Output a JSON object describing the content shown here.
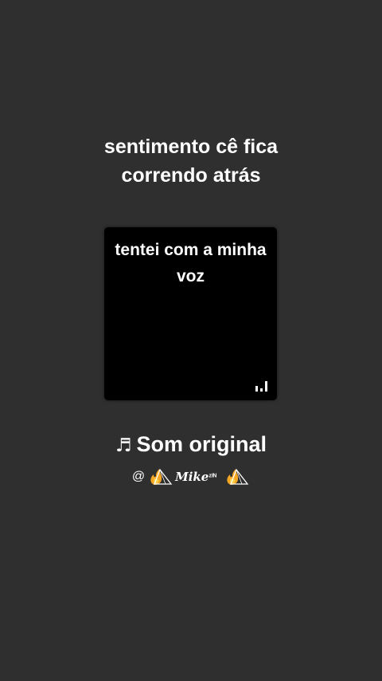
{
  "caption": {
    "line1": "sentimento cê fica",
    "line2": "correndo atrás"
  },
  "cover": {
    "text_line1": "tentei com a minha",
    "text_line2": "voz",
    "badge_icon": "audio-bars-icon"
  },
  "sound": {
    "note_icon": "♬",
    "title": "Som original"
  },
  "author": {
    "at": "@",
    "name": "Mike",
    "superscript": "ᶻᴵᴺ",
    "emblem_icon": "fire-triangle-emblem-icon"
  },
  "colors": {
    "background": "#2f2f2f",
    "cover": "#000000",
    "text": "#ffffff",
    "fire": "#f5a623"
  }
}
